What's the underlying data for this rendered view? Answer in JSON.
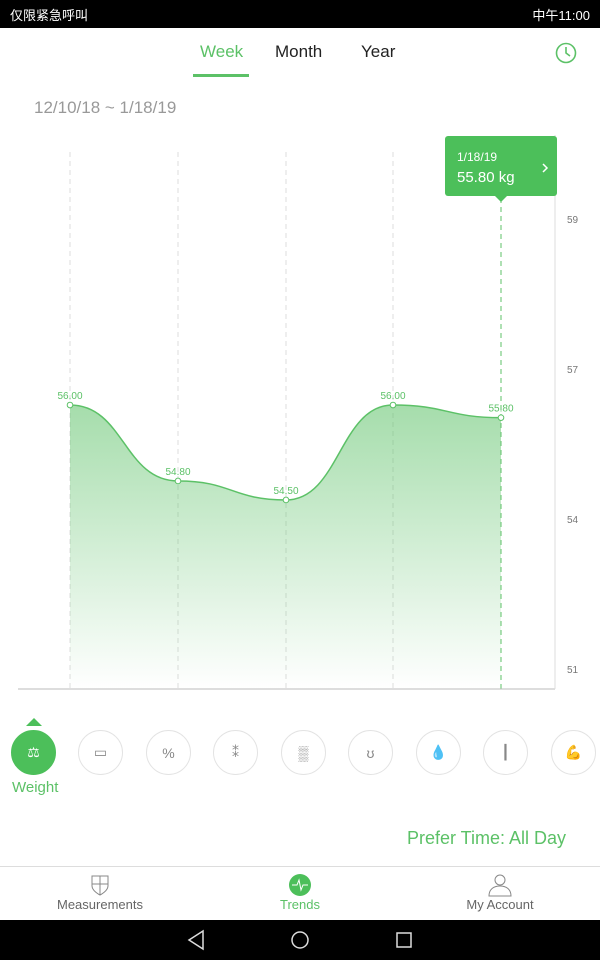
{
  "status_bar": {
    "left_text": "仅限紧急呼叫",
    "time": "中午11:00"
  },
  "tabs": [
    {
      "label": "Week",
      "active": true
    },
    {
      "label": "Month",
      "active": false
    },
    {
      "label": "Year",
      "active": false
    }
  ],
  "date_range": "12/10/18 ~ 1/18/19",
  "tooltip": {
    "date": "1/18/19",
    "value": "55.80 kg"
  },
  "chart_data": {
    "type": "area",
    "values": [
      56.0,
      54.8,
      54.5,
      56.0,
      55.8
    ],
    "point_labels": [
      "56.00",
      "54.80",
      "54.50",
      "56.00",
      "55.80"
    ],
    "y_tick_labels": [
      "59",
      "57",
      "54",
      "51"
    ],
    "selected_index": 4,
    "color": "#5cc167"
  },
  "metrics": [
    {
      "name": "Weight",
      "icon": "weight-icon",
      "active": true
    },
    {
      "icon": "ruler-icon"
    },
    {
      "icon": "percent-icon"
    },
    {
      "icon": "spine-icon"
    },
    {
      "icon": "fat-tissue-icon"
    },
    {
      "icon": "kidney-icon"
    },
    {
      "icon": "water-drops-icon"
    },
    {
      "icon": "bone-joint-icon"
    },
    {
      "icon": "muscle-icon"
    }
  ],
  "prefer_time": "Prefer Time: All Day",
  "bottom_nav": [
    {
      "label": "Measurements",
      "active": false
    },
    {
      "label": "Trends",
      "active": true
    },
    {
      "label": "My Account",
      "active": false
    }
  ],
  "accent": "#5cc167"
}
